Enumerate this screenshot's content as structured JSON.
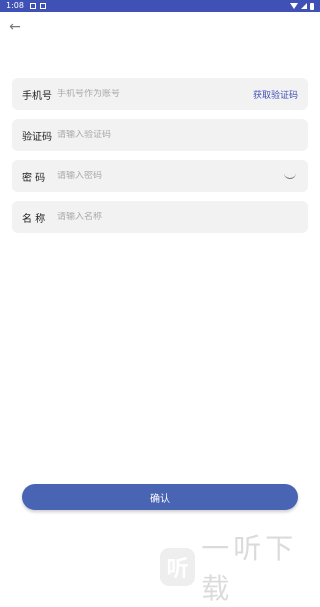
{
  "status_bar": {
    "time": "1:08",
    "icons": [
      "notification-icon",
      "notification-icon",
      "wifi-icon",
      "signal-icon",
      "battery-icon"
    ],
    "color": "#3f51b5"
  },
  "nav": {
    "back_icon": "arrow-left-icon",
    "back_glyph": "←"
  },
  "form": {
    "phone": {
      "label": "手机号",
      "placeholder": "手机号作为账号",
      "action": "获取验证码"
    },
    "code": {
      "label": "验证码",
      "placeholder": "请输入验证码"
    },
    "password": {
      "label": "密 码",
      "placeholder": "请输入密码",
      "toggle_icon": "eye-closed-icon"
    },
    "name": {
      "label": "名 称",
      "placeholder": "请输入名称"
    }
  },
  "confirm_label": "确认",
  "watermark": {
    "text": "一听下载",
    "logo_glyph": "听"
  },
  "colors": {
    "accent": "#3f51b5",
    "button": "#4a64b4",
    "field_bg": "#f2f2f2"
  }
}
